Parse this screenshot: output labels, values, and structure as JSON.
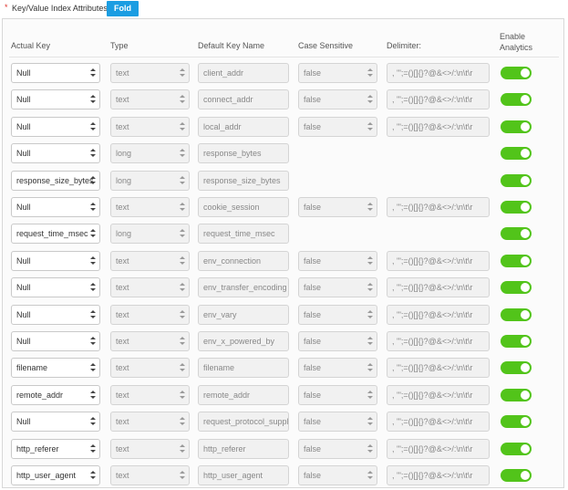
{
  "header": {
    "required_mark": "*",
    "label": "Key/Value Index Attributes:",
    "fold_label": "Fold"
  },
  "columns": {
    "actual_key": "Actual Key",
    "type": "Type",
    "default_key_name": "Default Key Name",
    "case_sensitive": "Case Sensitive",
    "delimiter": "Delimiter:",
    "enable_analytics_1": "Enable",
    "enable_analytics_2": "Analytics"
  },
  "rows": [
    {
      "key": "Null",
      "type": "text",
      "name": "client_addr",
      "case": "false",
      "delim": ", '\";=()[]{}?@&<>/:\\n\\t\\r",
      "analytics": true
    },
    {
      "key": "Null",
      "type": "text",
      "name": "connect_addr",
      "case": "false",
      "delim": ", '\";=()[]{}?@&<>/:\\n\\t\\r",
      "analytics": true
    },
    {
      "key": "Null",
      "type": "text",
      "name": "local_addr",
      "case": "false",
      "delim": ", '\";=()[]{}?@&<>/:\\n\\t\\r",
      "analytics": true
    },
    {
      "key": "Null",
      "type": "long",
      "name": "response_bytes",
      "case": null,
      "delim": null,
      "analytics": true
    },
    {
      "key": "response_size_bytes",
      "type": "long",
      "name": "response_size_bytes",
      "case": null,
      "delim": null,
      "analytics": true
    },
    {
      "key": "Null",
      "type": "text",
      "name": "cookie_session",
      "case": "false",
      "delim": ", '\";=()[]{}?@&<>/:\\n\\t\\r",
      "analytics": true
    },
    {
      "key": "request_time_msec",
      "type": "long",
      "name": "request_time_msec",
      "case": null,
      "delim": null,
      "analytics": true
    },
    {
      "key": "Null",
      "type": "text",
      "name": "env_connection",
      "case": "false",
      "delim": ", '\";=()[]{}?@&<>/:\\n\\t\\r",
      "analytics": true
    },
    {
      "key": "Null",
      "type": "text",
      "name": "env_transfer_encoding",
      "case": "false",
      "delim": ", '\";=()[]{}?@&<>/:\\n\\t\\r",
      "analytics": true
    },
    {
      "key": "Null",
      "type": "text",
      "name": "env_vary",
      "case": "false",
      "delim": ", '\";=()[]{}?@&<>/:\\n\\t\\r",
      "analytics": true
    },
    {
      "key": "Null",
      "type": "text",
      "name": "env_x_powered_by",
      "case": "false",
      "delim": ", '\";=()[]{}?@&<>/:\\n\\t\\r",
      "analytics": true
    },
    {
      "key": "filename",
      "type": "text",
      "name": "filename",
      "case": "false",
      "delim": ", '\";=()[]{}?@&<>/:\\n\\t\\r",
      "analytics": true
    },
    {
      "key": "remote_addr",
      "type": "text",
      "name": "remote_addr",
      "case": "false",
      "delim": ", '\";=()[]{}?@&<>/:\\n\\t\\r",
      "analytics": true
    },
    {
      "key": "Null",
      "type": "text",
      "name": "request_protocol_suppl",
      "case": "false",
      "delim": ", '\";=()[]{}?@&<>/:\\n\\t\\r",
      "analytics": true
    },
    {
      "key": "http_referer",
      "type": "text",
      "name": "http_referer",
      "case": "false",
      "delim": ", '\";=()[]{}?@&<>/:\\n\\t\\r",
      "analytics": true
    },
    {
      "key": "http_user_agent",
      "type": "text",
      "name": "http_user_agent",
      "case": "false",
      "delim": ", '\";=()[]{}?@&<>/:\\n\\t\\r",
      "analytics": true
    }
  ],
  "colors": {
    "accent": "#1b9de2",
    "toggle_on": "#52c41a",
    "required": "#e0322b"
  }
}
